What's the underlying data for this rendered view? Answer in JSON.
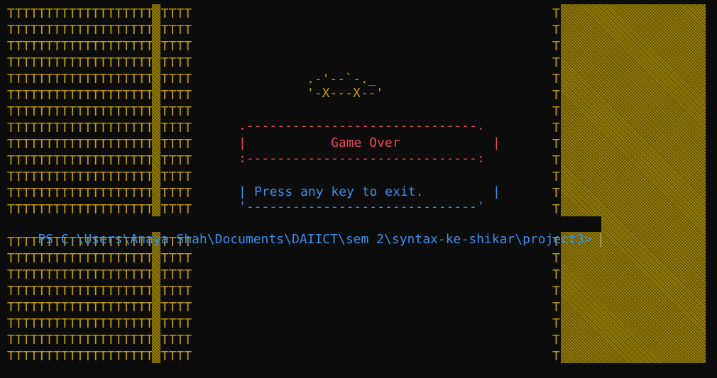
{
  "colors": {
    "background": "#0c0c0c",
    "track": "#c19c00",
    "game_over": "#e74856",
    "prompt": "#3b8eea"
  },
  "track": {
    "left_pattern": "TTTTTTTTTTTTTTTTTTTTTTTT",
    "right_pattern": "T"
  },
  "car": {
    "line1": ".-'--`-._",
    "line2": "'-X---X--'"
  },
  "game_over_box": {
    "top_border": ".------------------------------.",
    "left_edge": "|",
    "title": "Game Over",
    "right_edge": "|",
    "bottom_border": ":------------------------------:"
  },
  "exit_box": {
    "left_edge": "|",
    "message": "Press any key to exit.",
    "right_edge": "|",
    "bottom_border": "'------------------------------'"
  },
  "shell": {
    "prompt": "PS C:\\Users\\Anaya Shah\\Documents\\DAIICT\\sem 2\\syntax-ke-shikar\\project3>"
  }
}
